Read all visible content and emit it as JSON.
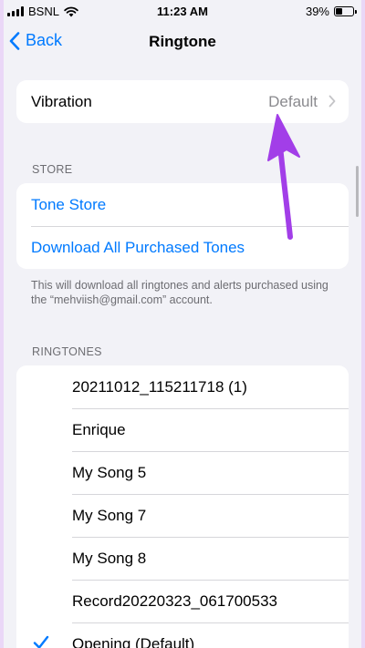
{
  "status_bar": {
    "carrier": "BSNL",
    "time": "11:23 AM",
    "battery_percent": "39%",
    "battery_level": 0.39,
    "wifi_icon": "wifi-icon",
    "signal_icon": "signal-bars-icon"
  },
  "nav": {
    "back_label": "Back",
    "title": "Ringtone"
  },
  "vibration": {
    "label": "Vibration",
    "value": "Default"
  },
  "store": {
    "header": "STORE",
    "items": [
      {
        "label": "Tone Store"
      },
      {
        "label": "Download All Purchased Tones"
      }
    ],
    "footer": "This will download all ringtones and alerts purchased using the “mehviish@gmail.com” account."
  },
  "ringtones": {
    "header": "RINGTONES",
    "items": [
      {
        "label": "20211012_115211718 (1)",
        "selected": false
      },
      {
        "label": "Enrique",
        "selected": false
      },
      {
        "label": "My Song 5",
        "selected": false
      },
      {
        "label": "My Song 7",
        "selected": false
      },
      {
        "label": "My Song 8",
        "selected": false
      },
      {
        "label": "Record20220323_061700533",
        "selected": false
      },
      {
        "label": "Opening (Default)",
        "selected": true
      }
    ]
  },
  "colors": {
    "accent": "#007aff",
    "annotation_arrow": "#a23ee8",
    "background": "#f2f2f7"
  }
}
